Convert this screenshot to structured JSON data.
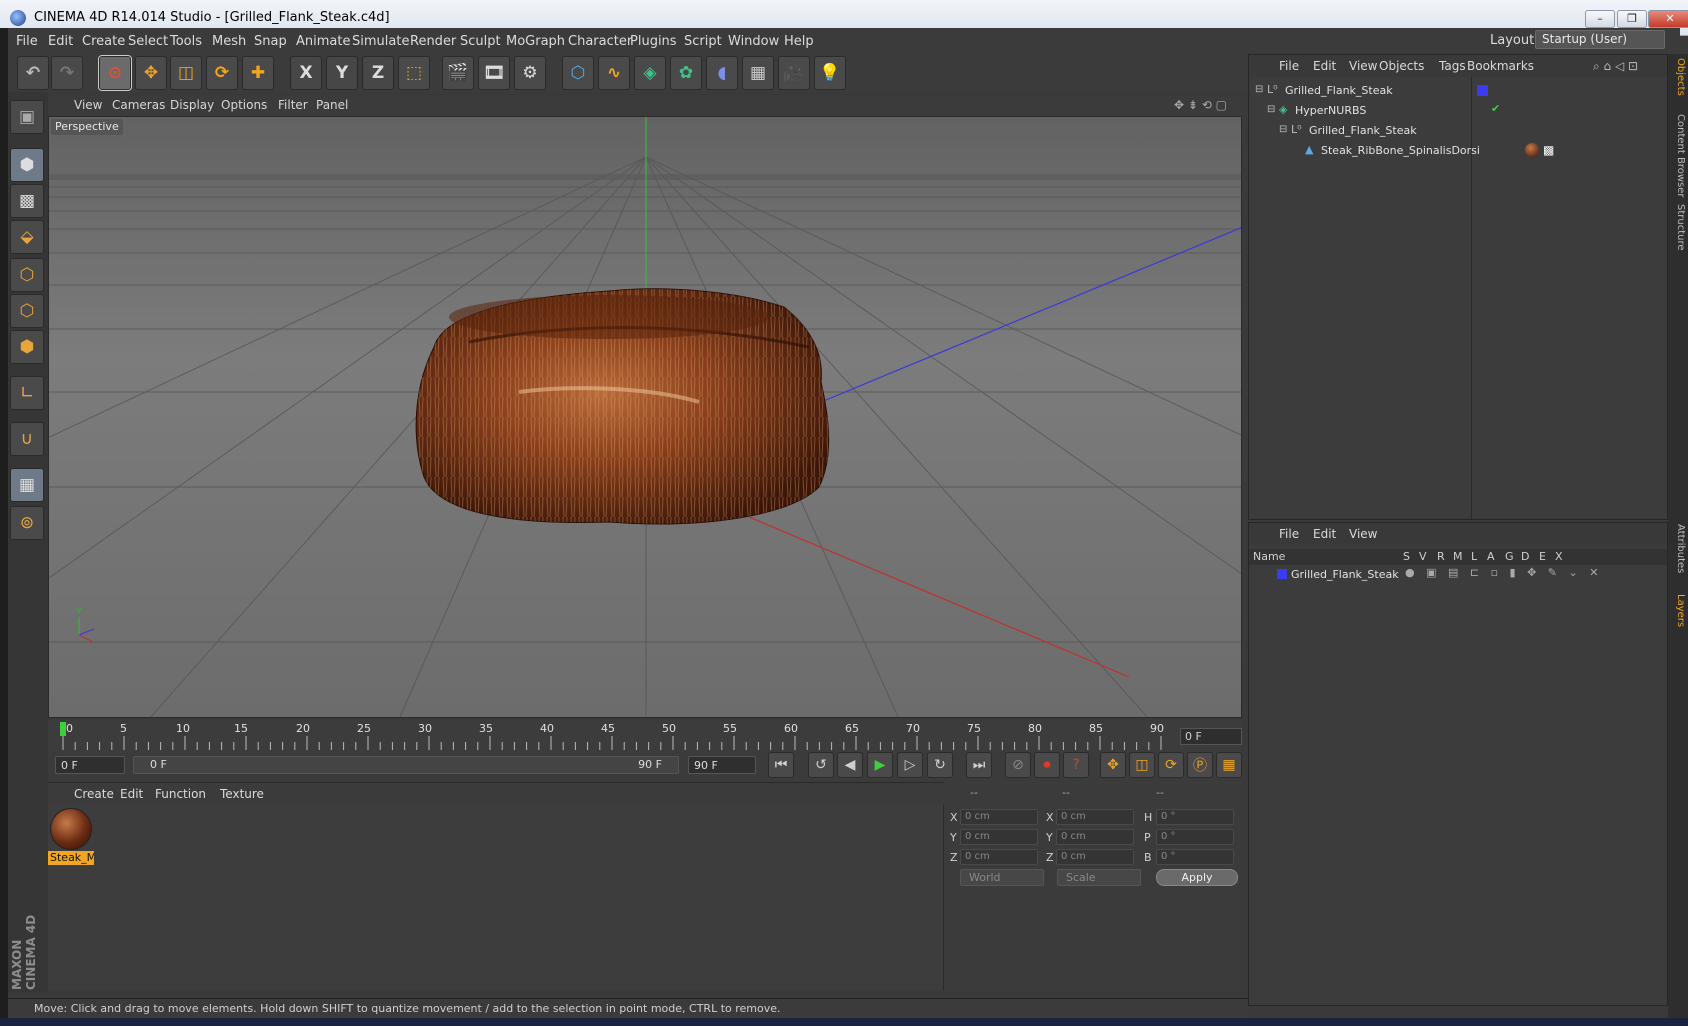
{
  "window": {
    "title": "CINEMA 4D R14.014 Studio - [Grilled_Flank_Steak.c4d]",
    "minimize": "–",
    "restore": "❐",
    "close": "✕"
  },
  "menu": [
    "File",
    "Edit",
    "Create",
    "Select",
    "Tools",
    "Mesh",
    "Snap",
    "Animate",
    "Simulate",
    "Render",
    "Sculpt",
    "MoGraph",
    "Character",
    "Plugins",
    "Script",
    "Window",
    "Help"
  ],
  "layout": {
    "label": "Layout:",
    "value": "Startup (User)"
  },
  "toolbar": {
    "axis_x": "X",
    "axis_y": "Y",
    "axis_z": "Z"
  },
  "viewport": {
    "menu": [
      "View",
      "Cameras",
      "Display",
      "Options",
      "Filter",
      "Panel"
    ],
    "label": "Perspective"
  },
  "timeline": {
    "ticks": [
      "0",
      "5",
      "10",
      "15",
      "20",
      "25",
      "30",
      "35",
      "40",
      "45",
      "50",
      "55",
      "60",
      "65",
      "70",
      "75",
      "80",
      "85",
      "90"
    ],
    "current_frame": "0 F",
    "start_field": "0 F",
    "range_start": "0 F",
    "range_end": "90 F",
    "end_field": "90 F"
  },
  "material_manager": {
    "menu": [
      "Create",
      "Edit",
      "Function",
      "Texture"
    ],
    "material_name": "Steak_M"
  },
  "coordinates": {
    "headers": [
      "--",
      "--",
      "--"
    ],
    "rows": [
      {
        "l1": "X",
        "v1": "0 cm",
        "l2": "X",
        "v2": "0 cm",
        "l3": "H",
        "v3": "0 °"
      },
      {
        "l1": "Y",
        "v1": "0 cm",
        "l2": "Y",
        "v2": "0 cm",
        "l3": "P",
        "v3": "0 °"
      },
      {
        "l1": "Z",
        "v1": "0 cm",
        "l2": "Z",
        "v2": "0 cm",
        "l3": "B",
        "v3": "0 °"
      }
    ],
    "space": "World",
    "mode": "Scale",
    "apply": "Apply"
  },
  "object_manager": {
    "menu": [
      "File",
      "Edit",
      "View",
      "Objects",
      "Tags",
      "Bookmarks"
    ],
    "items": [
      {
        "name": "Grilled_Flank_Steak",
        "indent": 0
      },
      {
        "name": "HyperNURBS",
        "indent": 1
      },
      {
        "name": "Grilled_Flank_Steak",
        "indent": 2
      },
      {
        "name": "Steak_RibBone_SpinalisDorsi",
        "indent": 3
      }
    ]
  },
  "layer_manager": {
    "menu": [
      "File",
      "Edit",
      "View"
    ],
    "columns": [
      "Name",
      "S",
      "V",
      "R",
      "M",
      "L",
      "A",
      "G",
      "D",
      "E",
      "X"
    ],
    "layer_name": "Grilled_Flank_Steak"
  },
  "side_tabs": [
    "Objects",
    "Content Browser",
    "Structure",
    "Attributes",
    "Layers"
  ],
  "status": "Move: Click and drag to move elements. Hold down SHIFT to quantize movement / add to the selection in point mode, CTRL to remove.",
  "brand": "MAXON CINEMA 4D",
  "colors": {
    "accent": "#f0a523",
    "layer_blue": "#3b3bf2",
    "axis_green": "#2fbf2f"
  }
}
